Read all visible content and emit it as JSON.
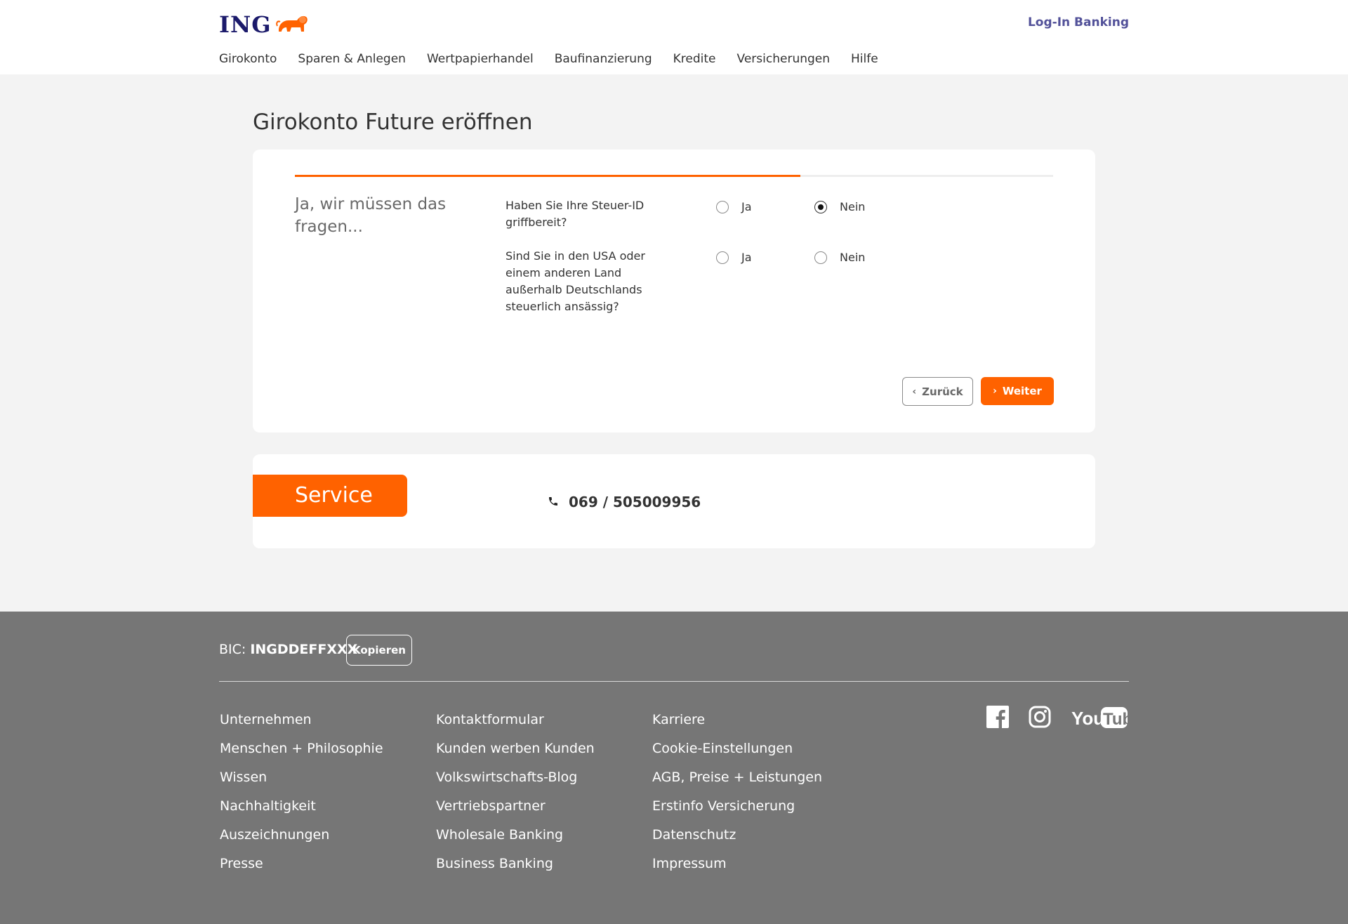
{
  "header": {
    "logo_text": "ING",
    "login_label": "Log-In Banking",
    "nav": [
      "Girokonto",
      "Sparen & Anlegen",
      "Wertpapierhandel",
      "Baufinanzierung",
      "Kredite",
      "Versicherungen",
      "Hilfe"
    ]
  },
  "page": {
    "title": "Girokonto Future eröffnen",
    "progress_fraction": 0.667
  },
  "form": {
    "section_title": "Ja, wir müssen das fragen...",
    "questions": [
      {
        "text": "Haben Sie Ihre Steuer-ID griffbereit?",
        "option_yes": "Ja",
        "option_no": "Nein",
        "selected": "Nein"
      },
      {
        "text": "Sind Sie in den USA oder einem anderen Land außerhalb Deutschlands steuerlich ansässig?",
        "option_yes": "Ja",
        "option_no": "Nein",
        "selected": ""
      }
    ],
    "back_label": "Zurück",
    "next_label": "Weiter"
  },
  "service": {
    "title": "Service",
    "phone": "069 / 505009956"
  },
  "footer": {
    "bic_label": "BIC:",
    "bic_value": "INGDDEFFXXX",
    "copy_label": "Kopieren",
    "col1": [
      "Unternehmen",
      "Menschen + Philosophie",
      "Wissen",
      "Nachhaltigkeit",
      "Auszeichnungen",
      "Presse"
    ],
    "col2": [
      "Kontaktformular",
      "Kunden werben Kunden",
      "Volkswirtschafts-Blog",
      "Vertriebspartner",
      "Wholesale Banking",
      "Business Banking"
    ],
    "col3": [
      "Karriere",
      "Cookie-Einstellungen",
      "AGB, Preise + Leistungen",
      "Erstinfo Versicherung",
      "Datenschutz",
      "Impressum"
    ],
    "social_icons": [
      "facebook-icon",
      "instagram-icon",
      "youtube-icon"
    ]
  },
  "colors": {
    "brand_orange": "#ff6200",
    "brand_blue": "#525199",
    "footer_bg": "#767676",
    "page_bg": "#f3f3f3"
  }
}
